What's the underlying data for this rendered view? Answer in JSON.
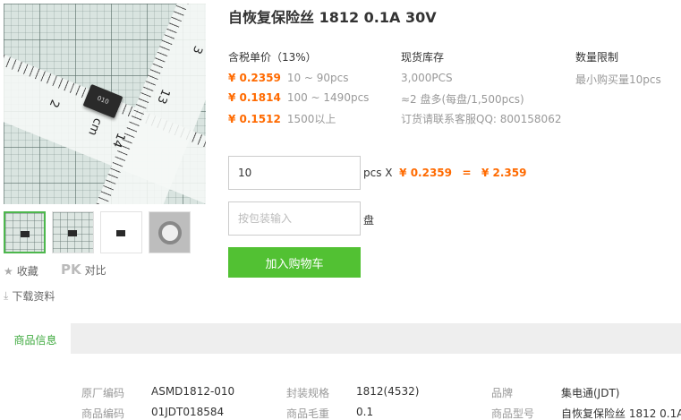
{
  "product": {
    "title": "自恢复保险丝 1812 0.1A 30V"
  },
  "image": {
    "ruler_numbers": [
      "2",
      "13",
      "cm",
      "14",
      "3"
    ],
    "chip_marking": "010"
  },
  "actions": {
    "favorite": "收藏",
    "compare_logo": "PK",
    "compare": "对比",
    "download": "下载资料"
  },
  "pricing": {
    "header": "含税单价（13%）",
    "tiers": [
      {
        "price": "¥ 0.2359",
        "qty": "10 ~ 90pcs"
      },
      {
        "price": "¥ 0.1814",
        "qty": "100 ~ 1490pcs"
      },
      {
        "price": "¥ 0.1512",
        "qty": "1500以上"
      }
    ]
  },
  "stock": {
    "header": "现货库存",
    "lines": [
      "3,000PCS",
      "≈2 盘多(每盘/1,500pcs)",
      "订货请联系客服QQ: 800158062"
    ]
  },
  "limit": {
    "header": "数量限制",
    "text": "最小购买量10pcs"
  },
  "order": {
    "quantity": "10",
    "unit": "pcs",
    "multiply": "X",
    "unit_price": "¥ 0.2359",
    "equals": "=",
    "total": "¥ 2.359",
    "pack_placeholder": "按包装输入",
    "pack_unit": "盘",
    "add_to_cart": "加入购物车"
  },
  "details": {
    "tab": "商品信息",
    "specs": [
      {
        "label": "原厂编码",
        "value": "ASMD1812-010"
      },
      {
        "label": "封装规格",
        "value": "1812(4532)"
      },
      {
        "label": "品牌",
        "value": "集电通(JDT)"
      },
      {
        "label": "商品编码",
        "value": "01JDT018584"
      },
      {
        "label": "商品毛重",
        "value": "0.1"
      },
      {
        "label": "商品型号",
        "value": "自恢复保险丝 1812 0.1A"
      }
    ]
  },
  "icons": {
    "star": "star-icon",
    "download": "download-icon"
  },
  "colors": {
    "accent_green": "#52c133",
    "price_orange": "#ff6a00",
    "tab_green": "#3faa3f"
  }
}
